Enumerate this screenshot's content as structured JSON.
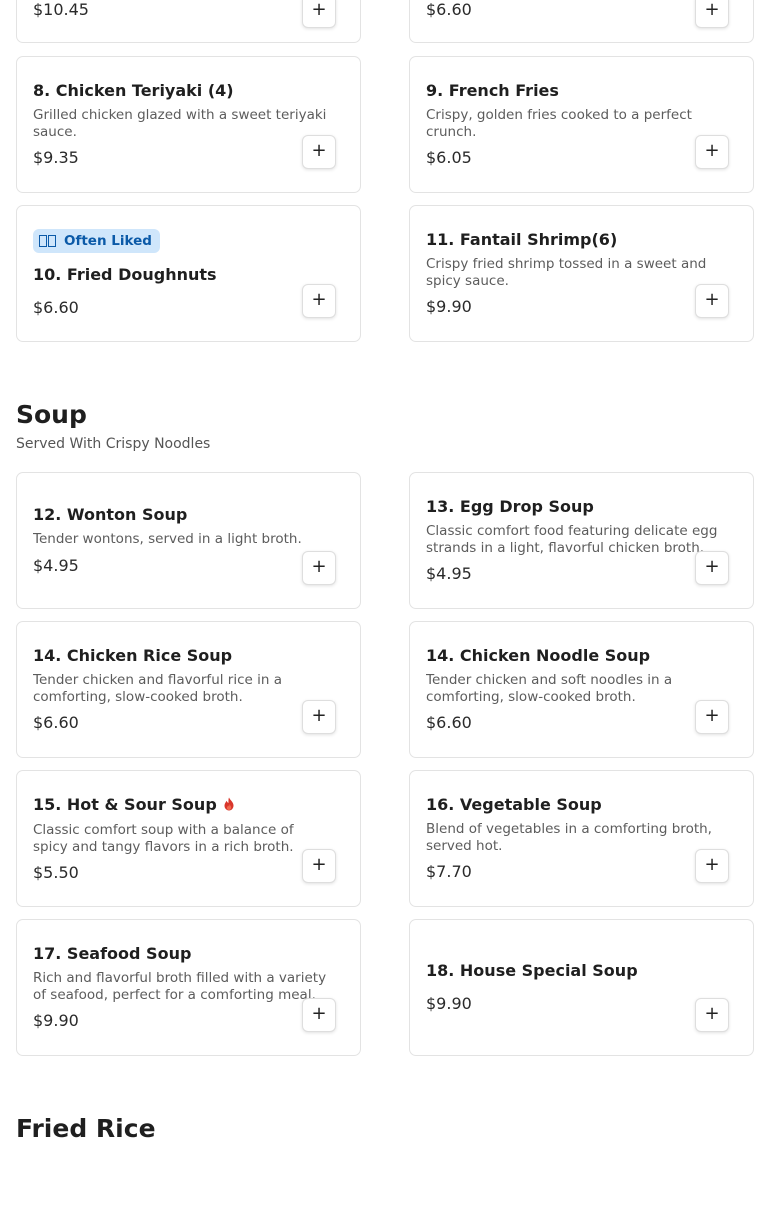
{
  "sections": {
    "top": {
      "items": [
        {
          "price": "$10.45"
        },
        {
          "price": "$6.60"
        },
        {
          "name": "8. Chicken Teriyaki (4)",
          "desc": "Grilled chicken glazed with a sweet teriyaki sauce.",
          "price": "$9.35"
        },
        {
          "name": "9. French Fries",
          "desc": "Crispy, golden fries cooked to a perfect crunch.",
          "price": "$6.05"
        },
        {
          "badge": "Often Liked",
          "name": "10. Fried Doughnuts",
          "price": "$6.60"
        },
        {
          "name": "11. Fantail Shrimp(6)",
          "desc": "Crispy fried shrimp tossed in a sweet and spicy sauce.",
          "price": "$9.90"
        }
      ]
    },
    "soup": {
      "title": "Soup",
      "subtitle": "Served With Crispy Noodles",
      "items": [
        {
          "name": "12. Wonton Soup",
          "desc": "Tender wontons, served in a light broth.",
          "price": "$4.95"
        },
        {
          "name": "13. Egg Drop Soup",
          "desc": "Classic comfort food featuring delicate egg strands in a light, flavorful chicken broth.",
          "price": "$4.95"
        },
        {
          "name": "14. Chicken Rice Soup",
          "desc": "Tender chicken and flavorful rice in a comforting, slow-cooked broth.",
          "price": "$6.60"
        },
        {
          "name": "14. Chicken Noodle Soup",
          "desc": "Tender chicken and soft noodles in a comforting, slow-cooked broth.",
          "price": "$6.60"
        },
        {
          "name": "15. Hot & Sour Soup",
          "desc": "Classic comfort soup with a balance of spicy and tangy flavors in a rich broth.",
          "price": "$5.50",
          "icon": "spicy-flame-icon"
        },
        {
          "name": "16. Vegetable Soup",
          "desc": "Blend of vegetables in a comforting broth, served hot.",
          "price": "$7.70"
        },
        {
          "name": "17. Seafood Soup",
          "desc": "Rich and flavorful broth filled with a variety of seafood, perfect for a comforting meal.",
          "price": "$9.90"
        },
        {
          "name": "18. House Special Soup",
          "price": "$9.90"
        }
      ]
    },
    "fried_rice": {
      "title": "Fried Rice"
    }
  },
  "add_button_label": "+",
  "colors": {
    "badge_bg": "#cfe6fb",
    "badge_text": "#0b5aa8",
    "spicy": "#d9362b",
    "card_border": "#e3e3e3"
  }
}
